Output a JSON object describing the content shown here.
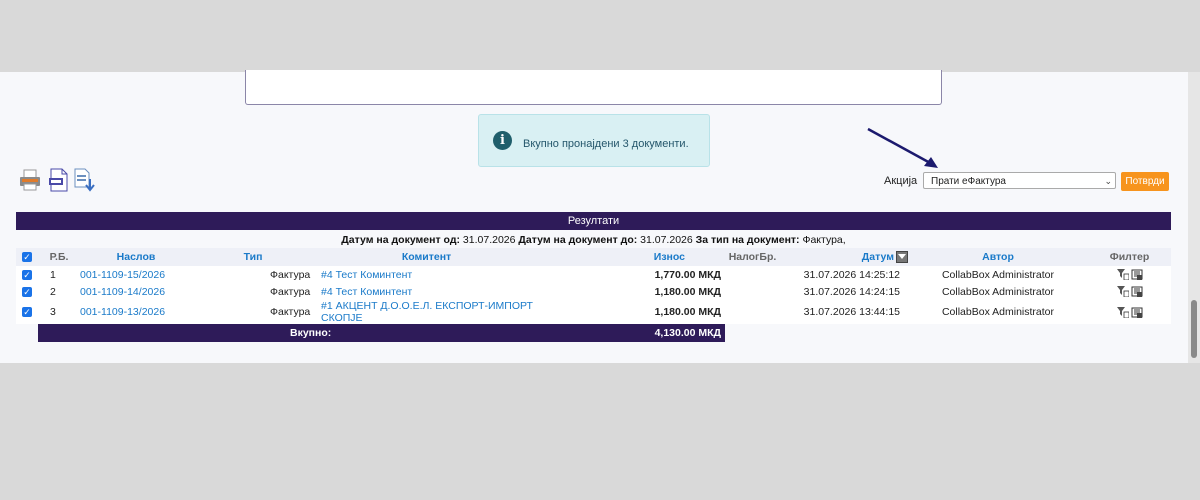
{
  "info": {
    "text": "Вкупно пронајдени 3 документи."
  },
  "toolbar": {
    "icons": [
      "print-icon",
      "export-pdf-icon",
      "export-download-icon"
    ]
  },
  "action": {
    "label": "Акција",
    "selected": "Прати еФактура",
    "confirm_label": "Потврди"
  },
  "results": {
    "title": "Резултати",
    "criteria": {
      "date_from_label": "Датум на документ од:",
      "date_from": "31.07.2026",
      "date_to_label": "Датум на документ до:",
      "date_to": "31.07.2026",
      "type_label": "За тип на документ:",
      "type": "Фактура,"
    },
    "columns": {
      "rb": "Р.Б.",
      "title": "Наслов",
      "type": "Тип",
      "client": "Комитент",
      "amount": "Износ",
      "tax_no": "НалогБр.",
      "date": "Датум",
      "author": "Автор",
      "filter": "Филтер"
    },
    "rows": [
      {
        "rb": "1",
        "title": "001-1109-15/2026",
        "type": "Фактура",
        "client": "#4 Тест Коминтент",
        "amount": "1,770.00 МКД",
        "date": "31.07.2026 14:25:12",
        "author": "CollabBox Administrator"
      },
      {
        "rb": "2",
        "title": "001-1109-14/2026",
        "type": "Фактура",
        "client": "#4 Тест Коминтент",
        "amount": "1,180.00 МКД",
        "date": "31.07.2026 14:24:15",
        "author": "CollabBox Administrator"
      },
      {
        "rb": "3",
        "title": "001-1109-13/2026",
        "type": "Фактура",
        "client": "#1 АКЦЕНТ Д.О.О.Е.Л. ЕКСПОРТ-ИМПОРТ СКОПЈЕ",
        "amount": "1,180.00 МКД",
        "date": "31.07.2026 13:44:15",
        "author": "CollabBox Administrator"
      }
    ],
    "total": {
      "label": "Вкупно:",
      "amount": "4,130.00 МКД"
    }
  },
  "colors": {
    "header_bg": "#2e1b59",
    "link": "#1a7ac9",
    "confirm_bg": "#f7941d",
    "info_bg": "#d9f0f3",
    "arrow": "#1c1a6e"
  }
}
